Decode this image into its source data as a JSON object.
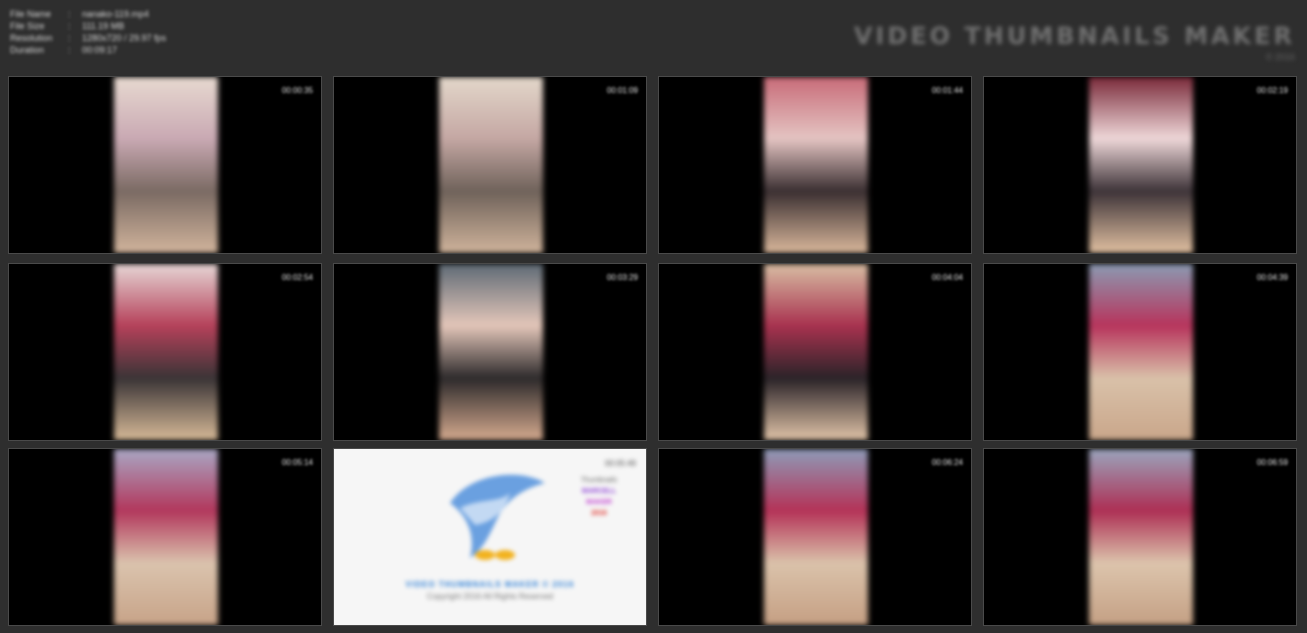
{
  "header": {
    "meta": [
      {
        "key": "File Name",
        "value": "nanako-119.mp4"
      },
      {
        "key": "File Size",
        "value": "111.19 MB"
      },
      {
        "key": "Resolution",
        "value": "1280x720 / 29.97 fps"
      },
      {
        "key": "Duration",
        "value": "00:09:17"
      }
    ],
    "brand_title": "VIDEO THUMBNAILS MAKER",
    "brand_url": "© 2016"
  },
  "tiles": [
    {
      "stamp": "00:00:35",
      "frame_colors": [
        "#e7d9d0",
        "#c9a9b3",
        "#7a6a63",
        "#d1b49c"
      ]
    },
    {
      "stamp": "00:01:09",
      "frame_colors": [
        "#e3d7ca",
        "#c4a7a3",
        "#6f625a",
        "#cfb39b"
      ]
    },
    {
      "stamp": "00:01:44",
      "frame_colors": [
        "#c86b78",
        "#e4c4c2",
        "#3a2f31",
        "#d9b79b"
      ]
    },
    {
      "stamp": "00:02:19",
      "frame_colors": [
        "#7a2a3a",
        "#eed7d8",
        "#3d3338",
        "#e1c0a1"
      ]
    },
    {
      "stamp": "00:02:54",
      "frame_colors": [
        "#e6d6d5",
        "#b5415a",
        "#3a3436",
        "#d6b997"
      ]
    },
    {
      "stamp": "00:03:29",
      "frame_colors": [
        "#5e6a75",
        "#e3c6b9",
        "#2d2a2b",
        "#d4a98e"
      ]
    },
    {
      "stamp": "00:04:04",
      "frame_colors": [
        "#d8bda3",
        "#a8324f",
        "#2a2328",
        "#e0c3a7"
      ]
    },
    {
      "stamp": "00:04:39",
      "frame_colors": [
        "#8b9ab2",
        "#b7345c",
        "#d9c1a9",
        "#c9a68a"
      ]
    },
    {
      "stamp": "00:05:14",
      "frame_colors": [
        "#a9a7c4",
        "#b2375c",
        "#dac3ad",
        "#c7a388"
      ]
    },
    {
      "stamp": "00:06:24",
      "frame_colors": [
        "#8e9bb8",
        "#b43257",
        "#dac2aa",
        "#c59f83"
      ]
    },
    {
      "stamp": "00:06:59",
      "frame_colors": [
        "#9aa5bd",
        "#ad2f54",
        "#dcc4ac",
        "#c4a084"
      ]
    }
  ],
  "logo_tile": {
    "stamp": "00:05:49",
    "side_lines": [
      "Thumbnails",
      "MARCELL",
      "MAKER",
      "2016"
    ],
    "side_colors": [
      "#666666",
      "#8e3fd6",
      "#c03ad0",
      "#e0302a"
    ],
    "caption": "VIDEO THUMBNAILS MAKER © 2016",
    "copyright": "Copyright 2016 All Rights Reserved",
    "bird_color": "#6aa0e0",
    "accent_color": "#f2b21e"
  },
  "colors": {
    "background": "#2e2e2e",
    "tile_border": "#4a4a4a",
    "accent": "#2d7fd6"
  },
  "icons": {
    "logo": "bird-logo-icon"
  }
}
